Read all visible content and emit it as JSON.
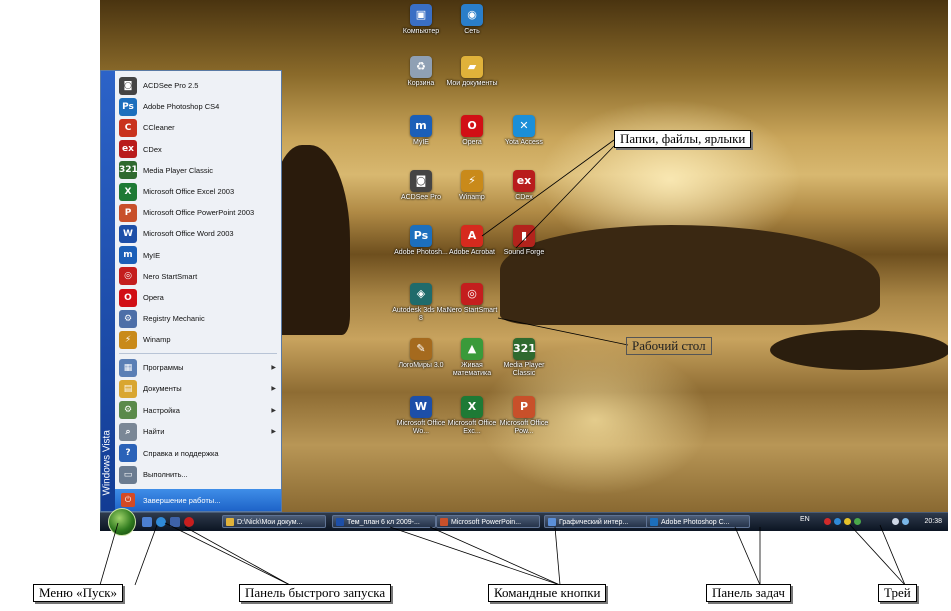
{
  "desktop": {
    "icons": [
      {
        "label": "Компьютер",
        "icon": "computer-icon",
        "color": "#3a6fc4",
        "glyph": "▣"
      },
      {
        "label": "Сеть",
        "icon": "network-icon",
        "color": "#2a7ec9",
        "glyph": "◉"
      },
      {
        "label": "Корзина",
        "icon": "recycle-bin-icon",
        "color": "#8fa0b4",
        "glyph": "♻"
      },
      {
        "label": "Мои документы",
        "icon": "folder-icon",
        "color": "#e0b23a",
        "glyph": "▰"
      },
      {
        "label": "MyIE",
        "icon": "myie-icon",
        "color": "#1b5fb8",
        "glyph": "m"
      },
      {
        "label": "Opera",
        "icon": "opera-icon",
        "color": "#d10f15",
        "glyph": "O"
      },
      {
        "label": "Yota Access",
        "icon": "yota-icon",
        "color": "#1b8fd8",
        "glyph": "✕"
      },
      {
        "label": "ACDSee Pro",
        "icon": "acdsee-icon",
        "color": "#444",
        "glyph": "◙"
      },
      {
        "label": "Winamp",
        "icon": "winamp-icon",
        "color": "#c98a1a",
        "glyph": "⚡"
      },
      {
        "label": "CDex",
        "icon": "cdex-icon",
        "color": "#b91c1c",
        "glyph": "ex"
      },
      {
        "label": "Adobe Photosh...",
        "icon": "photoshop-icon",
        "color": "#1c6fbd",
        "glyph": "Ps"
      },
      {
        "label": "Adobe Acrobat",
        "icon": "acrobat-icon",
        "color": "#d62a1e",
        "glyph": "A"
      },
      {
        "label": "Sound Forge",
        "icon": "sound-forge-icon",
        "color": "#b3231c",
        "glyph": "▮"
      },
      {
        "label": "Autodesk 3ds Max 8",
        "icon": "3dsmax-icon",
        "color": "#1f6b6b",
        "glyph": "◈"
      },
      {
        "label": "Nero StartSmart",
        "icon": "nero-icon",
        "color": "#c41e1e",
        "glyph": "◎"
      },
      {
        "label": "ЛогоМиры 3.0",
        "icon": "logomiry-icon",
        "color": "#a56a1e",
        "glyph": "✎"
      },
      {
        "label": "Живая математика",
        "icon": "live-math-icon",
        "color": "#3a9a3a",
        "glyph": "▲"
      },
      {
        "label": "Media Player Classic",
        "icon": "mpc-icon",
        "color": "#2f6a2f",
        "glyph": "321"
      },
      {
        "label": "Microsoft Office Wo...",
        "icon": "word-icon",
        "color": "#1d4fa8",
        "glyph": "W"
      },
      {
        "label": "Microsoft Office Exc...",
        "icon": "excel-icon",
        "color": "#1e7a35",
        "glyph": "X"
      },
      {
        "label": "Microsoft Office Pow...",
        "icon": "powerpoint-icon",
        "color": "#c8502a",
        "glyph": "P"
      }
    ]
  },
  "start_menu": {
    "side_text": "Windows Vista",
    "pinned": [
      {
        "label": "ACDSee Pro 2.5",
        "icon": "acdsee-icon",
        "color": "#444",
        "glyph": "◙"
      },
      {
        "label": "Adobe Photoshop CS4",
        "icon": "photoshop-icon",
        "color": "#1c6fbd",
        "glyph": "Ps"
      },
      {
        "label": "CCleaner",
        "icon": "ccleaner-icon",
        "color": "#c9331e",
        "glyph": "C"
      },
      {
        "label": "CDex",
        "icon": "cdex-icon",
        "color": "#b91c1c",
        "glyph": "ex"
      },
      {
        "label": "Media Player Classic",
        "icon": "mpc-icon",
        "color": "#2f6a2f",
        "glyph": "321"
      },
      {
        "label": "Microsoft Office Excel 2003",
        "icon": "excel-icon",
        "color": "#1e7a35",
        "glyph": "X"
      },
      {
        "label": "Microsoft Office PowerPoint 2003",
        "icon": "powerpoint-icon",
        "color": "#c8502a",
        "glyph": "P"
      },
      {
        "label": "Microsoft Office Word 2003",
        "icon": "word-icon",
        "color": "#1d4fa8",
        "glyph": "W"
      },
      {
        "label": "MyIE",
        "icon": "myie-icon",
        "color": "#1b5fb8",
        "glyph": "m"
      },
      {
        "label": "Nero StartSmart",
        "icon": "nero-icon",
        "color": "#c41e1e",
        "glyph": "◎"
      },
      {
        "label": "Opera",
        "icon": "opera-icon",
        "color": "#d10f15",
        "glyph": "O"
      },
      {
        "label": "Registry Mechanic",
        "icon": "registry-mechanic-icon",
        "color": "#4d6fa8",
        "glyph": "⚙"
      },
      {
        "label": "Winamp",
        "icon": "winamp-icon",
        "color": "#c98a1a",
        "glyph": "⚡"
      }
    ],
    "system": [
      {
        "label": "Программы",
        "icon": "programs-icon",
        "color": "#5a7fb5",
        "glyph": "▦",
        "submenu": true
      },
      {
        "label": "Документы",
        "icon": "documents-icon",
        "color": "#d9a630",
        "glyph": "▤",
        "submenu": true
      },
      {
        "label": "Настройка",
        "icon": "settings-icon",
        "color": "#5a8a4a",
        "glyph": "⚙",
        "submenu": true
      },
      {
        "label": "Найти",
        "icon": "search-icon",
        "color": "#7a8796",
        "glyph": "⌕",
        "submenu": true
      },
      {
        "label": "Справка и поддержка",
        "icon": "help-icon",
        "color": "#2a62b8",
        "glyph": "?",
        "submenu": false
      },
      {
        "label": "Выполнить...",
        "icon": "run-icon",
        "color": "#6a7b90",
        "glyph": "▭",
        "submenu": false
      }
    ],
    "shutdown_label": "Завершение работы..."
  },
  "taskbar": {
    "buttons": [
      {
        "label": "D:\\Nick\\Мои докум...",
        "icon": "folder-icon",
        "color": "#e0b23a"
      },
      {
        "label": "Тем_план 6 кл 2009-...",
        "icon": "word-icon",
        "color": "#1d4fa8"
      },
      {
        "label": "Microsoft PowerPoin...",
        "icon": "powerpoint-icon",
        "color": "#c8502a"
      },
      {
        "label": "Графический интер...",
        "icon": "picture-icon",
        "color": "#5b8fd8"
      },
      {
        "label": "Adobe Photoshop C...",
        "icon": "photoshop-icon",
        "color": "#1c6fbd"
      }
    ],
    "language": "EN",
    "clock": "20:38"
  },
  "callouts": {
    "files": "Папки, файлы, ярлыки",
    "desktop": "Рабочий стол",
    "start_menu": "Меню «Пуск»",
    "quick_launch": "Панель быстрого запуска",
    "command_buttons": "Командные кнопки",
    "taskbar": "Панель задач",
    "tray": "Трей"
  }
}
